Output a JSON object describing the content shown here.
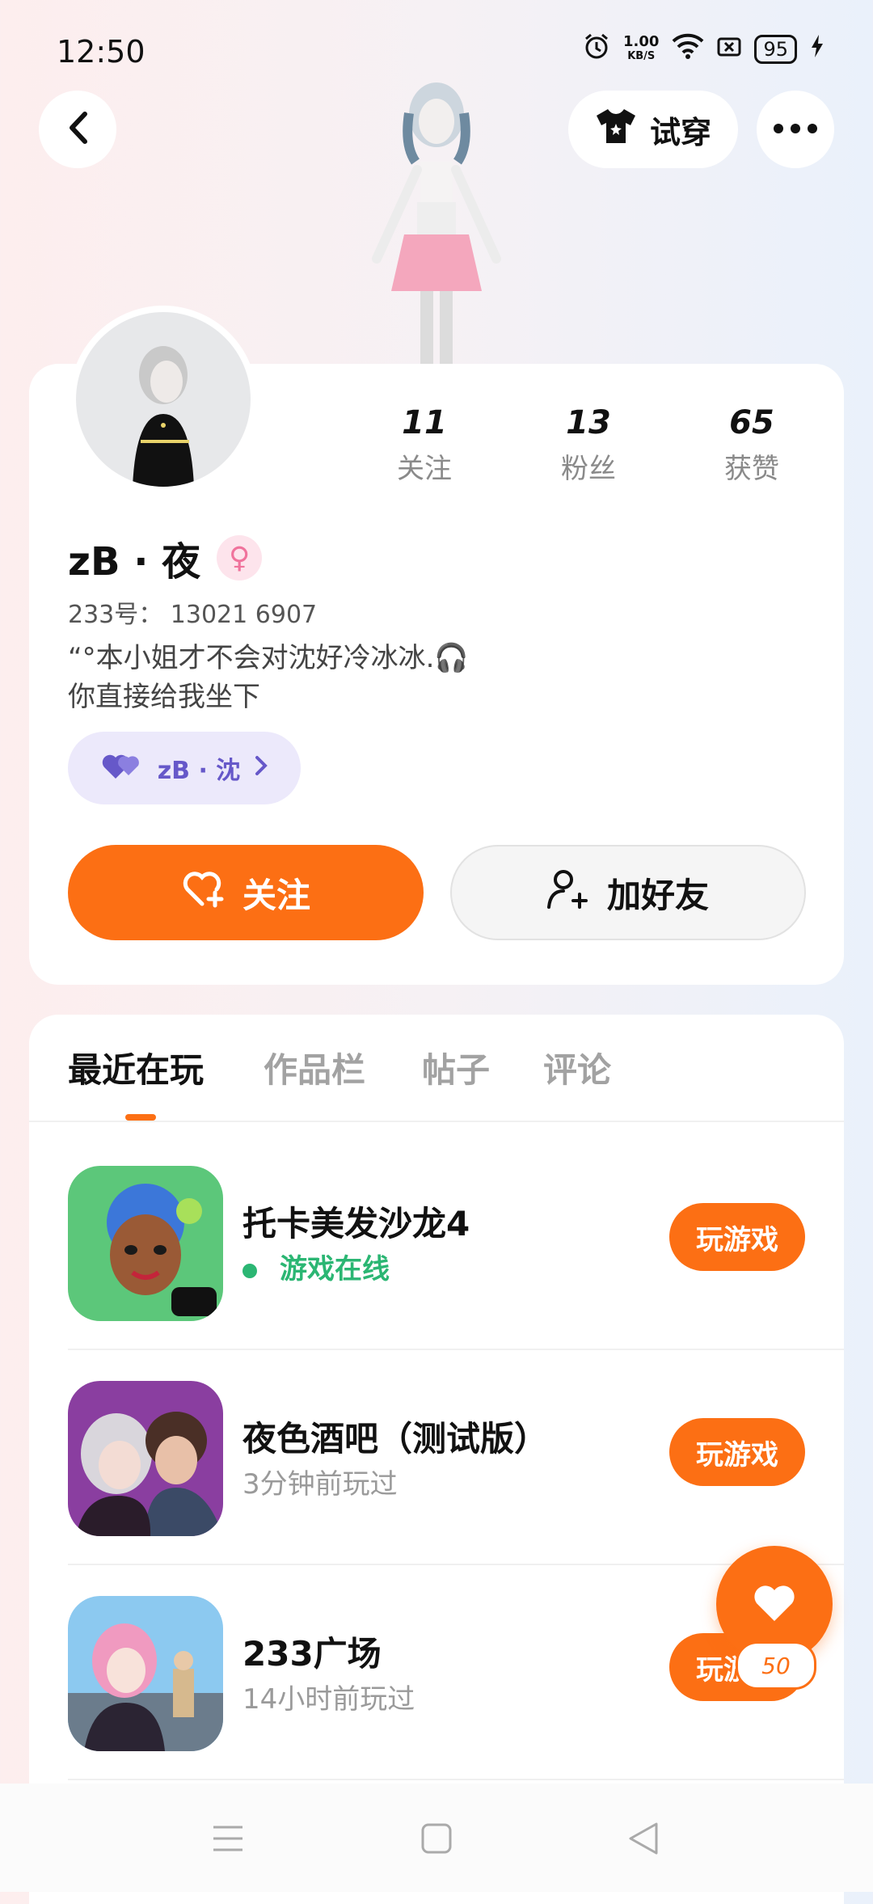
{
  "status_bar": {
    "time": "12:50",
    "speed_value": "1.00",
    "speed_unit": "KB/S",
    "battery": "95"
  },
  "header": {
    "try_on_label": "试穿"
  },
  "profile": {
    "stats": [
      {
        "value": "11",
        "label": "关注"
      },
      {
        "value": "13",
        "label": "粉丝"
      },
      {
        "value": "65",
        "label": "获赞"
      }
    ],
    "name": "zB · 夜",
    "uid": "233号： 13021 6907",
    "bio_line1": "“°本小姐才不会对沈好冷冰冰.🎧",
    "bio_line2": "你直接给我坐下",
    "cp_label": "zB · 沈",
    "follow_label": "关注",
    "add_friend_label": "加好友"
  },
  "tabs": [
    "最近在玩",
    "作品栏",
    "帖子",
    "评论"
  ],
  "games": [
    {
      "title": "托卡美发沙龙4",
      "status": "游戏在线",
      "button": "玩游戏"
    },
    {
      "title": "夜色酒吧（测试版）",
      "status": "3分钟前玩过",
      "button": "玩游戏"
    },
    {
      "title": "233广场",
      "status": "14小时前玩过",
      "button": "玩游戏"
    }
  ],
  "like_count": "50",
  "colors": {
    "accent": "#fc6f14",
    "online": "#2bb673",
    "cp": "#6658c9"
  }
}
